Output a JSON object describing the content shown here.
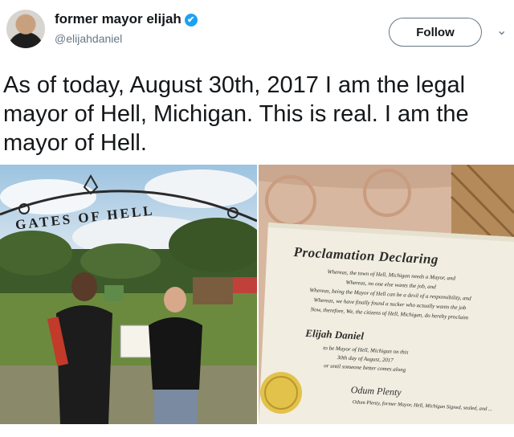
{
  "tweet": {
    "display_name": "former mayor elijah",
    "verified_icon": "verified-badge-icon",
    "handle": "@elijahdaniel",
    "follow_label": "Follow",
    "menu_icon": "chevron-down-icon",
    "text": "As of today, August 30th, 2017 I am the legal mayor of Hell, Michigan. This is real. I am the mayor of Hell."
  },
  "photo_left": {
    "sign_text": "GATES OF HELL"
  },
  "certificate": {
    "title": "Proclamation Declaring",
    "body_lines": [
      "Whereas, the town of Hell, Michigan needs a Mayor, and",
      "Whereas, no one else wants the job, and",
      "Whereas, being the Mayor of Hell can be a devil of a responsibility, and",
      "Whereas, we have finally found a sucker who actually wants the job",
      "Now, therefore, We, the citizens of Hell, Michigan, do hereby proclaim"
    ],
    "name": "Elijah Daniel",
    "lines_after": [
      "to be Mayor of Hell, Michigan on this",
      "30th day of August, 2017",
      "or until someone better comes along"
    ],
    "signature": "Odum Plenty",
    "signature_caption": "Odum Plenty, former Mayor, Hell, Michigan Signed, sealed, and ..."
  },
  "colors": {
    "verified": "#1da1f2",
    "text": "#14171a",
    "muted": "#657786"
  }
}
